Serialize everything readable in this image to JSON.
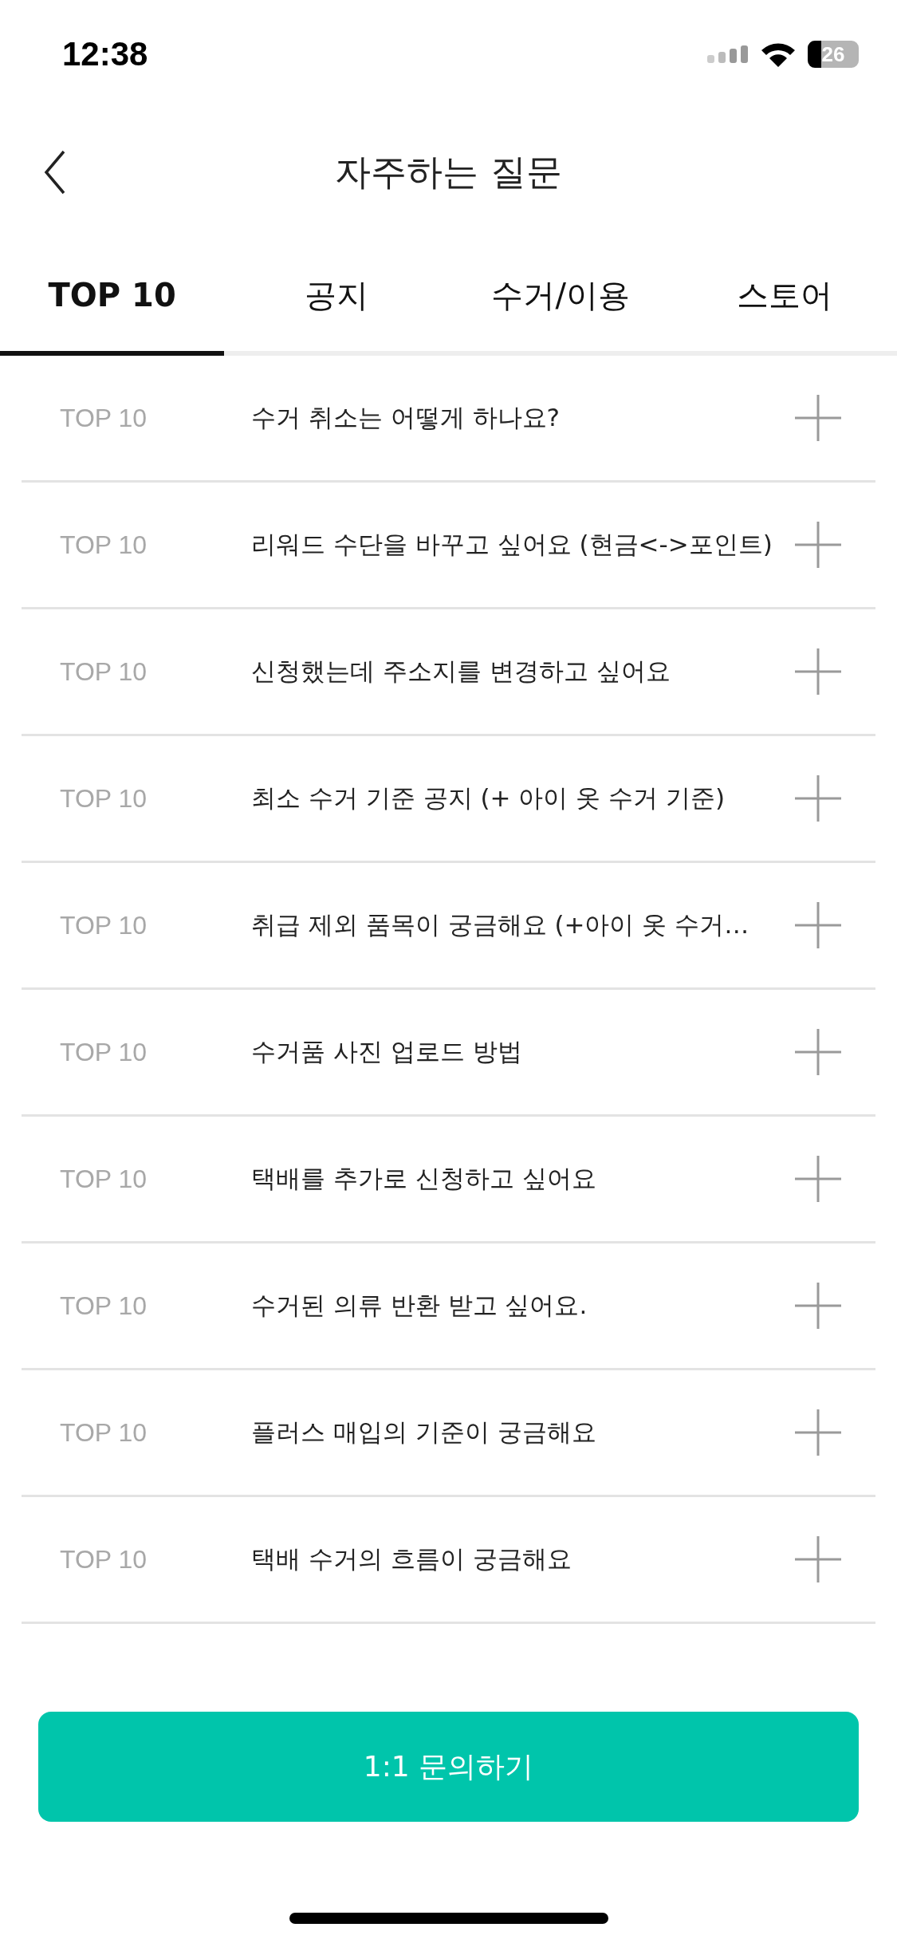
{
  "status_bar": {
    "time": "12:38",
    "battery": "26"
  },
  "header": {
    "title": "자주하는 질문"
  },
  "tabs": [
    {
      "label": "TOP 10",
      "selected": true
    },
    {
      "label": "공지",
      "selected": false
    },
    {
      "label": "수거/이용",
      "selected": false
    },
    {
      "label": "스토어",
      "selected": false
    }
  ],
  "faq": [
    {
      "category": "TOP 10",
      "question": "수거 취소는 어떻게 하나요?",
      "expanded": false
    },
    {
      "category": "TOP 10",
      "question": "리워드 수단을 바꾸고 싶어요 (현금<->포인트)",
      "expanded": false
    },
    {
      "category": "TOP 10",
      "question": "신청했는데 주소지를 변경하고 싶어요",
      "expanded": false
    },
    {
      "category": "TOP 10",
      "question": "최소 수거 기준 공지 (+ 아이 옷 수거 기준)",
      "expanded": false
    },
    {
      "category": "TOP 10",
      "question": "취급 제외 품목이 궁금해요 (+아이 옷 수거…",
      "expanded": false
    },
    {
      "category": "TOP 10",
      "question": "수거품 사진 업로드 방법",
      "expanded": false
    },
    {
      "category": "TOP 10",
      "question": "택배를 추가로 신청하고 싶어요",
      "expanded": false
    },
    {
      "category": "TOP 10",
      "question": "수거된 의류 반환 받고 싶어요.",
      "expanded": false
    },
    {
      "category": "TOP 10",
      "question": "플러스 매입의 기준이 궁금해요",
      "expanded": false
    },
    {
      "category": "TOP 10",
      "question": "택배 수거의 흐름이 궁금해요",
      "expanded": false
    }
  ],
  "contact_button": {
    "label": "1:1 문의하기"
  }
}
